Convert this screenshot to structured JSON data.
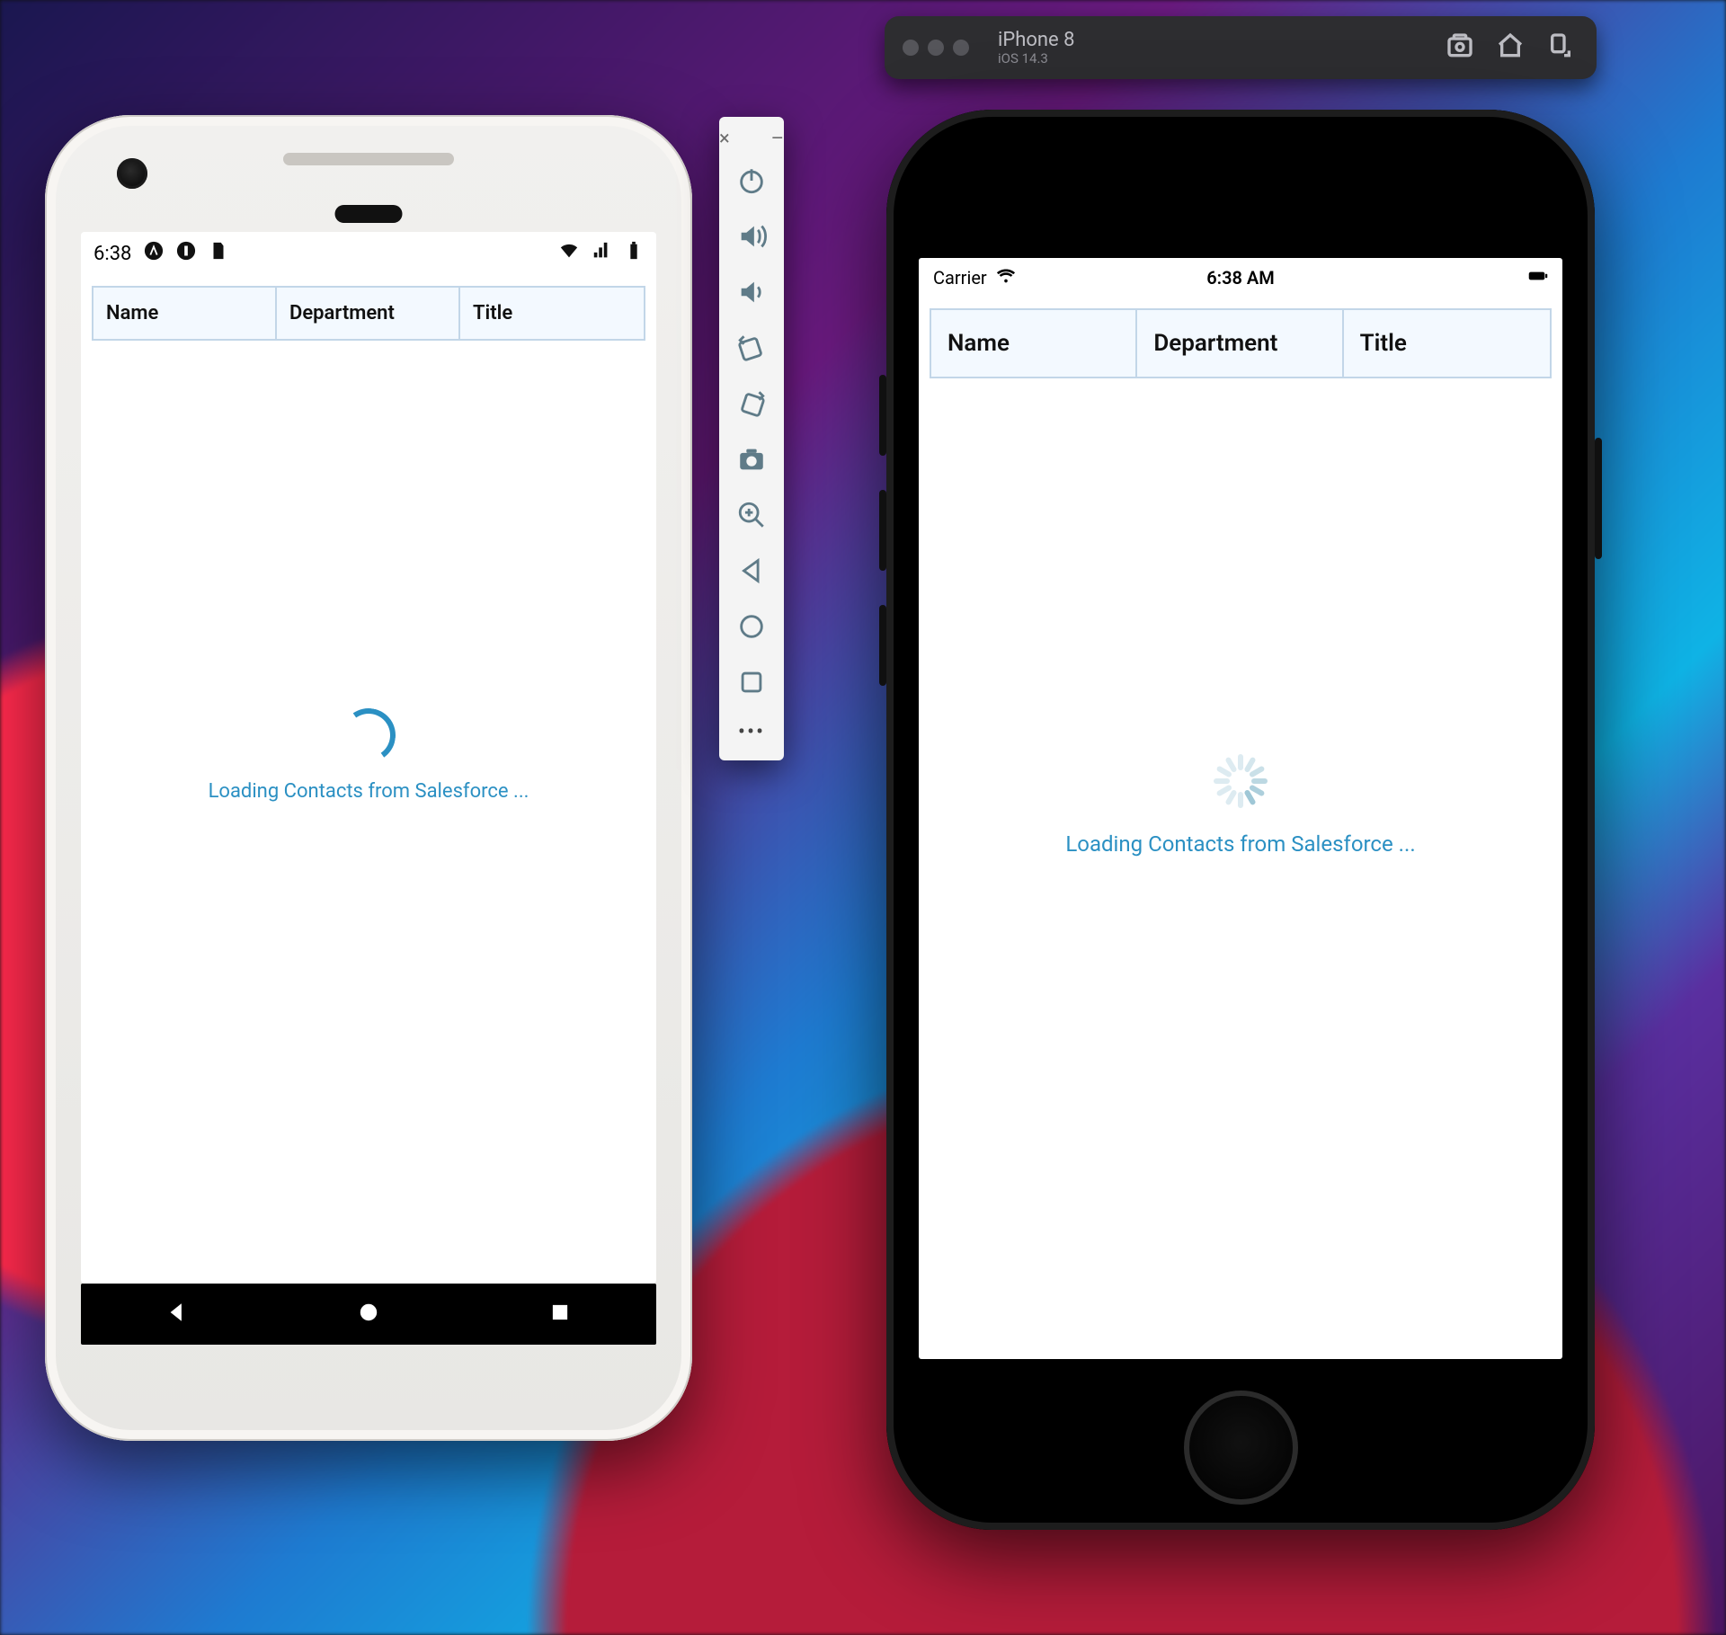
{
  "simulator": {
    "device_label": "iPhone 8",
    "os_label": "iOS 14.3"
  },
  "android": {
    "status_time": "6:38",
    "carrier_label": ""
  },
  "iphone": {
    "carrier": "Carrier",
    "time": "6:38 AM"
  },
  "table": {
    "headers": [
      "Name",
      "Department",
      "Title"
    ]
  },
  "loading_message": "Loading Contacts from Salesforce ...",
  "emu_sidebar": {
    "close_glyph": "×",
    "min_glyph": "–",
    "more_glyph": "•••"
  }
}
